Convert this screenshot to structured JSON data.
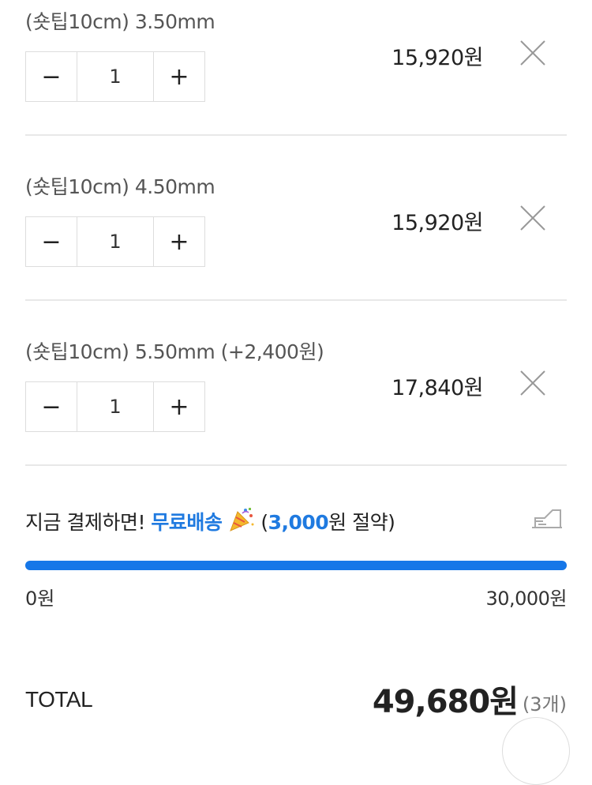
{
  "items": [
    {
      "option": "(숏팁10cm) 3.50mm",
      "qty": "1",
      "price": "15,920원",
      "minus": "−",
      "plus": "+"
    },
    {
      "option": "(숏팁10cm) 4.50mm",
      "qty": "1",
      "price": "15,920원",
      "minus": "−",
      "plus": "+"
    },
    {
      "option": "(숏팁10cm) 5.50mm (+2,400원)",
      "qty": "1",
      "price": "17,840원",
      "minus": "−",
      "plus": "+"
    }
  ],
  "shipping": {
    "prefix": "지금 결제하면! ",
    "free_label": "무료배송",
    "emoji_icon": "party-popper-icon",
    "open_paren": " (",
    "saved_amount": "3,000",
    "suffix": "원 절약)",
    "progress_percent": 100,
    "min_label": "0원",
    "max_label": "30,000원",
    "accent_color": "#1677e8"
  },
  "total": {
    "label": "TOTAL",
    "value": "49,680원",
    "count": "(3개)"
  }
}
